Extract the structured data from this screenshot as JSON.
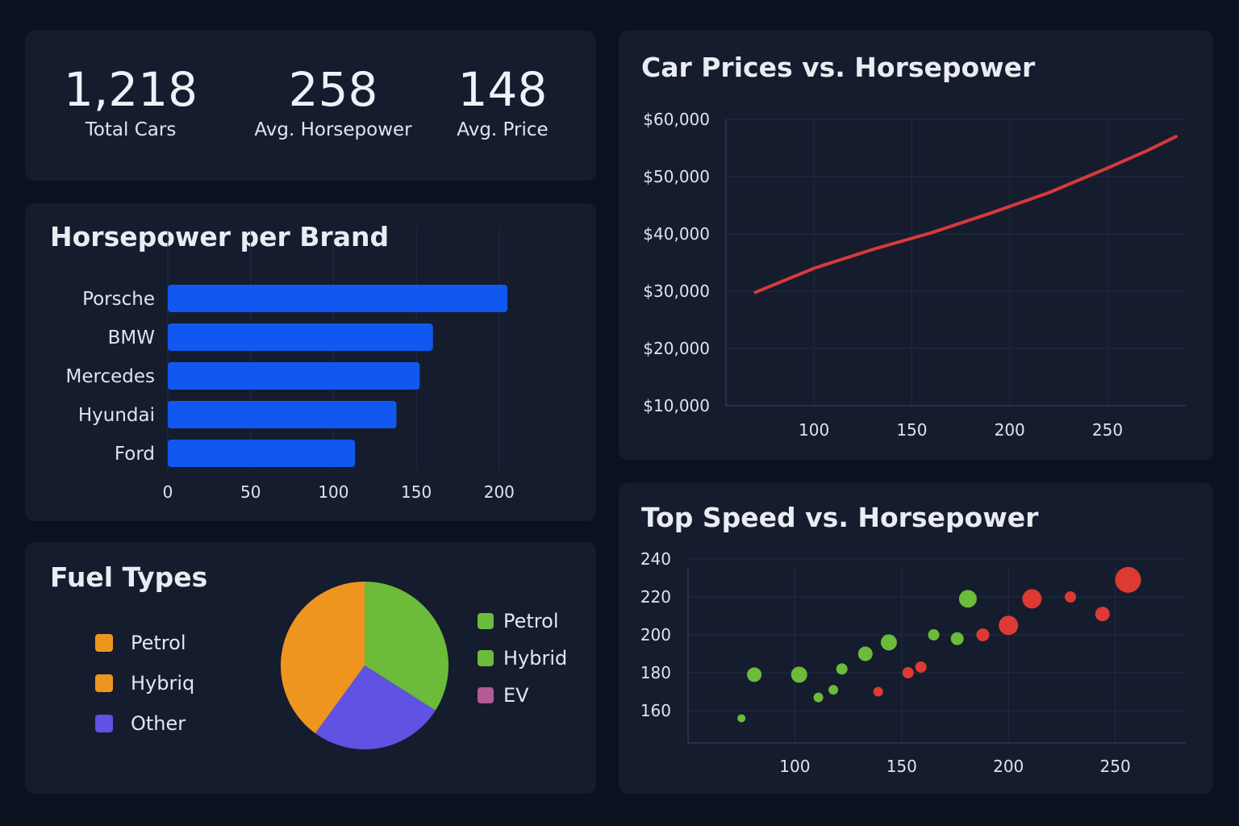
{
  "kpis": [
    {
      "value": "1,218",
      "label": "Total Cars"
    },
    {
      "value": "258",
      "label": "Avg. Horsepower"
    },
    {
      "value": "148",
      "label": "Avg. Price"
    }
  ],
  "titles": {
    "horsepower": "Horsepower per Brand",
    "fuel": "Fuel Types",
    "price": "Car Prices vs. Horsepower",
    "speed": "Top Speed vs. Horsepower"
  },
  "colors": {
    "background": "#0c1120",
    "card": "#151c2e",
    "bar": "#1158f0",
    "line": "#d63a3a",
    "petrol_orange": "#ee951f",
    "hybrid_green": "#6cbb3a",
    "other_purple": "#6052e2",
    "ev_pink": "#b45a95",
    "scatter_red": "#dc3a32"
  },
  "fuel_legend_left": [
    {
      "label": "Petrol",
      "color": "#ee951f"
    },
    {
      "label": "Hybriq",
      "color": "#ee951f"
    },
    {
      "label": "Other",
      "color": "#6052e2"
    }
  ],
  "fuel_legend_right": [
    {
      "label": "Petrol",
      "color": "#6cbb3a"
    },
    {
      "label": "Hybrid",
      "color": "#6cbb3a"
    },
    {
      "label": "EV",
      "color": "#b45a95"
    }
  ],
  "chart_data": [
    {
      "id": "horsepower-per-brand",
      "type": "bar",
      "orientation": "horizontal",
      "title": "Horsepower per Brand",
      "categories": [
        "Porsche",
        "BMW",
        "Mercedes",
        "Hyundai",
        "Ford"
      ],
      "values": [
        205,
        160,
        152,
        138,
        113
      ],
      "xticks": [
        0,
        50,
        100,
        150,
        200
      ],
      "xlim": [
        0,
        240
      ],
      "grid": true,
      "color": "#1158f0"
    },
    {
      "id": "fuel-types",
      "type": "pie",
      "title": "Fuel Types",
      "slices": [
        {
          "label": "Hybrid",
          "value": 34,
          "color": "#6cbb3a"
        },
        {
          "label": "Other",
          "value": 26,
          "color": "#6052e2"
        },
        {
          "label": "Petrol",
          "value": 40,
          "color": "#ee951f"
        }
      ]
    },
    {
      "id": "price-vs-horsepower",
      "type": "line",
      "title": "Car Prices vs. Horsepower",
      "x": [
        70,
        100,
        130,
        160,
        190,
        220,
        250,
        270,
        285
      ],
      "y": [
        29800,
        34000,
        37300,
        40200,
        43600,
        47200,
        51500,
        54500,
        57000
      ],
      "xticks": [
        100,
        150,
        200,
        250
      ],
      "yticks": [
        "$10,000",
        "$20,000",
        "$30,000",
        "$40,000",
        "$50,000",
        "$60,000"
      ],
      "ytick_values": [
        10000,
        20000,
        30000,
        40000,
        50000,
        60000
      ],
      "xlim": [
        55,
        290
      ],
      "ylim": [
        10000,
        60000
      ],
      "grid": true,
      "color": "#d63a3a"
    },
    {
      "id": "speed-vs-horsepower",
      "type": "scatter",
      "title": "Top Speed vs. Horsepower",
      "xticks": [
        100,
        150,
        200,
        250
      ],
      "yticks": [
        160,
        180,
        200,
        220,
        240
      ],
      "xlim": [
        50,
        283
      ],
      "ylim": [
        143,
        240
      ],
      "grid": true,
      "points": [
        {
          "x": 75,
          "y": 156,
          "size": 5,
          "color": "#6cbb3a"
        },
        {
          "x": 81,
          "y": 179,
          "size": 9,
          "color": "#6cbb3a"
        },
        {
          "x": 102,
          "y": 179,
          "size": 10,
          "color": "#6cbb3a"
        },
        {
          "x": 111,
          "y": 167,
          "size": 6,
          "color": "#6cbb3a"
        },
        {
          "x": 118,
          "y": 171,
          "size": 6,
          "color": "#6cbb3a"
        },
        {
          "x": 122,
          "y": 182,
          "size": 7,
          "color": "#6cbb3a"
        },
        {
          "x": 133,
          "y": 190,
          "size": 9,
          "color": "#6cbb3a"
        },
        {
          "x": 144,
          "y": 196,
          "size": 10,
          "color": "#6cbb3a"
        },
        {
          "x": 165,
          "y": 200,
          "size": 7,
          "color": "#6cbb3a"
        },
        {
          "x": 176,
          "y": 198,
          "size": 8,
          "color": "#6cbb3a"
        },
        {
          "x": 181,
          "y": 219,
          "size": 11,
          "color": "#6cbb3a"
        },
        {
          "x": 139,
          "y": 170,
          "size": 6,
          "color": "#dc3a32"
        },
        {
          "x": 153,
          "y": 180,
          "size": 7,
          "color": "#dc3a32"
        },
        {
          "x": 159,
          "y": 183,
          "size": 7,
          "color": "#dc3a32"
        },
        {
          "x": 188,
          "y": 200,
          "size": 8,
          "color": "#dc3a32"
        },
        {
          "x": 200,
          "y": 205,
          "size": 12,
          "color": "#dc3a32"
        },
        {
          "x": 211,
          "y": 219,
          "size": 12,
          "color": "#dc3a32"
        },
        {
          "x": 229,
          "y": 220,
          "size": 7,
          "color": "#dc3a32"
        },
        {
          "x": 244,
          "y": 211,
          "size": 9,
          "color": "#dc3a32"
        },
        {
          "x": 256,
          "y": 229,
          "size": 16,
          "color": "#dc3a32"
        }
      ]
    }
  ]
}
